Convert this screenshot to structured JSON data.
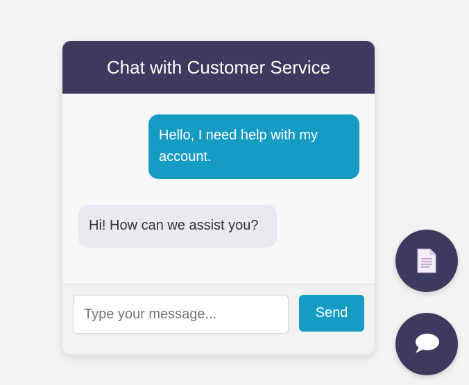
{
  "header": {
    "title": "Chat with Customer Service"
  },
  "messages": [
    {
      "sender": "user",
      "text": "Hello, I need help with my account."
    },
    {
      "sender": "agent",
      "text": "Hi! How can we assist you?"
    }
  ],
  "composer": {
    "placeholder": "Type your message...",
    "value": "",
    "send_label": "Send"
  },
  "floating_buttons": [
    {
      "icon": "document-icon"
    },
    {
      "icon": "chat-bubble-icon"
    }
  ],
  "colors": {
    "header_bg": "#3d3a5f",
    "accent": "#169cc3",
    "agent_bubble": "#e7eaee",
    "page_bg": "#f3f3f3"
  }
}
